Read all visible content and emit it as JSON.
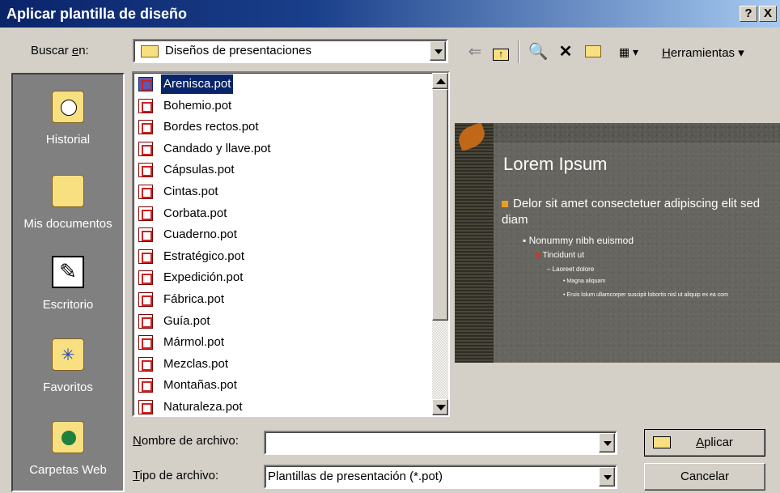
{
  "window": {
    "title": "Aplicar plantilla de diseño",
    "help_glyph": "?",
    "close_glyph": "X"
  },
  "look_in": {
    "label_pre": "Buscar ",
    "label_key": "e",
    "label_post": "n:",
    "value": "Diseños de presentaciones"
  },
  "toolbar": {
    "back_icon": "back-arrow-icon",
    "up_icon": "up-folder-icon",
    "search_icon": "search-web-icon",
    "delete_icon": "delete-icon",
    "new_folder_icon": "new-folder-icon",
    "views_icon": "views-icon",
    "tools_key": "H",
    "tools_rest": "erramientas"
  },
  "places": [
    {
      "label": "Historial",
      "icon": "history-icon"
    },
    {
      "label": "Mis documentos",
      "icon": "my-documents-icon"
    },
    {
      "label": "Escritorio",
      "icon": "desktop-icon"
    },
    {
      "label": "Favoritos",
      "icon": "favorites-icon"
    },
    {
      "label": "Carpetas Web",
      "icon": "web-folders-icon"
    }
  ],
  "files": [
    "Arenisca.pot",
    "Bohemio.pot",
    "Bordes rectos.pot",
    "Candado y llave.pot",
    "Cápsulas.pot",
    "Cintas.pot",
    "Corbata.pot",
    "Cuaderno.pot",
    "Estratégico.pot",
    "Expedición.pot",
    "Fábrica.pot",
    "Guía.pot",
    "Mármol.pot",
    "Mezclas.pot",
    "Montañas.pot",
    "Naturaleza.pot"
  ],
  "selected_file_index": 0,
  "preview": {
    "title": "Lorem Ipsum",
    "bullet1": "Delor sit amet consectetuer adipiscing elit sed diam",
    "bullet2": "Nonummy nibh euismod",
    "bullet3": "Tincidunt ut",
    "bullet4": "Laoreet dolore",
    "bullet5": "Magna aliquam",
    "bullet6": "Eruis lolum ullamcorper suscipit lobortis nisl ut aliquip ex ea com"
  },
  "filename": {
    "label_key": "N",
    "label_rest": "ombre de archivo:",
    "value": ""
  },
  "filetype": {
    "label_key": "T",
    "label_rest": "ipo de archivo:",
    "value": "Plantillas de presentación (*.pot)"
  },
  "buttons": {
    "apply_key": "A",
    "apply_rest": "plicar",
    "cancel": "Cancelar"
  }
}
